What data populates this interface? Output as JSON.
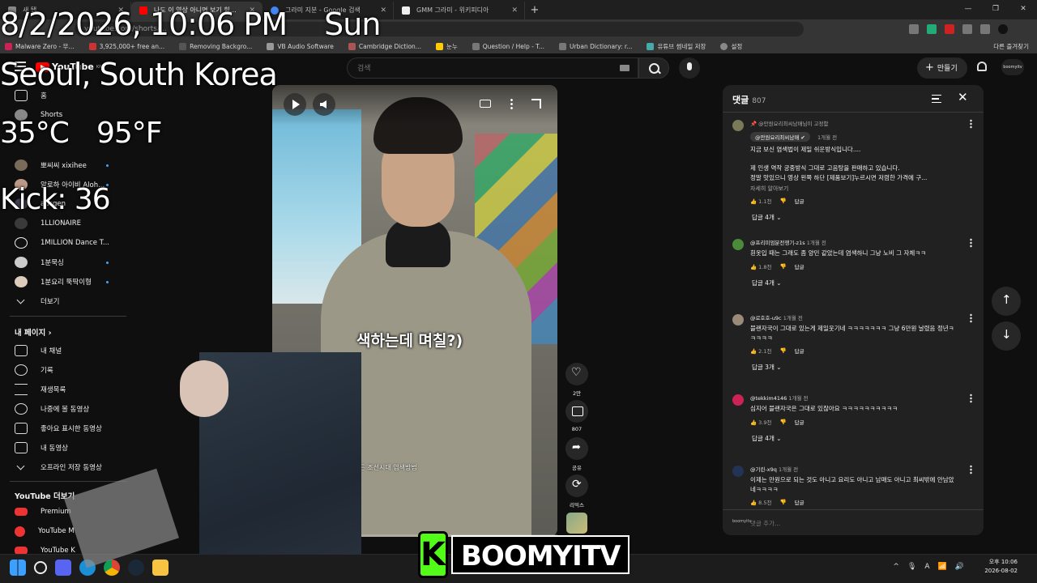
{
  "browser": {
    "tabs": [
      {
        "title": "새 탭",
        "color": "#888888"
      },
      {
        "title": "나도 이 영상 아니면 보기 힘든 조선...",
        "color": "#ff0000"
      },
      {
        "title": "그라미 지분 - Google 검색",
        "color": "#4285f4"
      },
      {
        "title": "GMM 그라미 - 위키피디아",
        "color": "#eeeeee"
      }
    ],
    "url": "youtube.com/shorts/...",
    "bookmarks": [
      "Malware Zero - 무...",
      "3,925,000+ free an...",
      "Removing Backgro...",
      "VB Audio Software",
      "Cambridge Diction...",
      "눈누",
      "Question / Help - T...",
      "Urban Dictionary: r...",
      "유튜브 썸네일 저장",
      "설정"
    ],
    "bookmarks_right": "다른 즐겨찾기"
  },
  "youtube": {
    "logo": "YouTube",
    "logo_region": "KR",
    "search_placeholder": "검색",
    "create_label": "만들기",
    "account": "boomyitv"
  },
  "sidebar": {
    "top_items": [
      "홈",
      "Shorts"
    ],
    "subscriptions": [
      "뽀씨씨 xixihee",
      "알로하 아이비 Aloh...",
      "ausgen",
      "1LLIONAIRE",
      "1MILLION Dance T...",
      "1분묵싱",
      "1분요리 뚝딱이형"
    ],
    "more_label": "더보기",
    "my_page_heading": "내 페이지",
    "my_page_items": [
      "내 채널",
      "기록",
      "재생목록",
      "나중에 볼 동영상",
      "좋아요 표시한 동영상",
      "내 동영상",
      "오프라인 저장 동영상"
    ],
    "more_youtube_heading": "YouTube 더보기",
    "more_youtube_items": [
      "Premium",
      "YouTube M",
      "YouTube K"
    ]
  },
  "video": {
    "caption": "색하는데 며칠?)",
    "title_small": "힘든 조선시대 염색방법",
    "progress": 0.12
  },
  "actions": {
    "likes": "2만",
    "comments": "807",
    "share": "공유",
    "remix": "리믹스"
  },
  "comments": {
    "title": "댓글",
    "count": "807",
    "input_placeholder": "댓글 추가...",
    "list": [
      {
        "author": "@만원요리최씨남매님이 고정함",
        "badge": "@만원요리최씨남매",
        "time": "1개월 전",
        "text": "지금 보신 염색법이 제일 쉬운방식입니다....\n\n제 인생 역작 궁중방식 그대로 고음탕을 판매하고 있습니다.\n정말 맛있으니  영상 왼쪽 하단 [제품보기]누르시면 저렴한 가격에 구...",
        "read_more": "자세히 알아보기",
        "likes": "1.1천",
        "replies": "답글 4개",
        "avatar_color": "#7a7a5a"
      },
      {
        "author": "@프리미엄분전쟁기-z1s",
        "time": "1개월 전",
        "text": "흰옷입 때는 그래도 좀 양민 같았는데 염색하니 그냥 노비 그 자체ㅋㅋ",
        "likes": "1.8천",
        "replies": "답글 4개",
        "avatar_color": "#4a8a3a"
      },
      {
        "author": "@로호호-u9c",
        "time": "1개월 전",
        "text": "블랜자국이 그대로 있는게 제일웃기네 ㅋㅋㅋㅋㅋㅋㅋ 그냥 6만원 날렸음 정년ㅋㅋㅋㅋㅋ",
        "likes": "2.1천",
        "replies": "답글 3개",
        "avatar_color": "#9a8a7a"
      },
      {
        "author": "@tekkim4146",
        "time": "1개월 전",
        "text": "심지어 블랜자국은 그대로 있잖아요 ㅋㅋㅋㅋㅋㅋㅋㅋㅋㅋ",
        "likes": "3.9천",
        "replies": "답글 4개",
        "avatar_color": "#cc2255"
      },
      {
        "author": "@기린-x9q",
        "time": "1개월 전",
        "text": "이제는 만원으로 되는 것도 아니고 요리도 아니고 남매도 아니고 최씨밖에 안남았네ㅋㅋㅋㅋ",
        "likes": "8.5천",
        "replies": "",
        "avatar_color": "#223355"
      }
    ],
    "reply_label": "답글"
  },
  "overlay": {
    "datetime": "8/2/2026, 10:06 PM",
    "weekday": "Sun",
    "location": "Seoul, South Korea",
    "temp_c": "35°C",
    "temp_f": "95°F",
    "kick_count": "Kick: 36",
    "brand": "BOOMYITV",
    "brand_k": "K",
    "brand_color": "#53fc18"
  },
  "taskbar": {
    "time": "오후 10:06",
    "date": "2026-08-02",
    "tray": [
      "^",
      "🎙",
      "A",
      "📶",
      "🔊"
    ]
  }
}
